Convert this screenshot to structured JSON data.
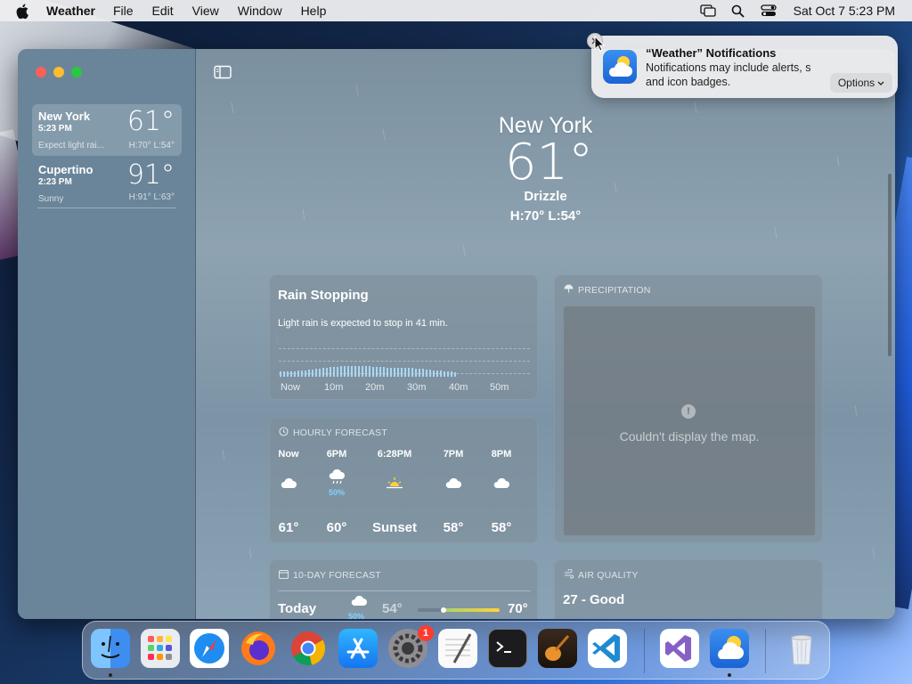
{
  "menubar": {
    "app_name": "Weather",
    "items": [
      "File",
      "Edit",
      "View",
      "Window",
      "Help"
    ],
    "clock": "Sat Oct 7  5:23 PM"
  },
  "sidebar": {
    "locations": [
      {
        "name": "New York",
        "time": "5:23 PM",
        "temp": "61°",
        "condition": "Expect light rai...",
        "high_low": "H:70°  L:54°"
      },
      {
        "name": "Cupertino",
        "time": "2:23 PM",
        "temp": "91°",
        "condition": "Sunny",
        "high_low": "H:91°  L:63°"
      }
    ]
  },
  "current": {
    "city": "New York",
    "temp": "61°",
    "condition": "Drizzle",
    "high_low": "H:70°  L:54°"
  },
  "rain_card": {
    "title": "Rain Stopping",
    "description": "Light rain is expected to stop in 41 min.",
    "axis": [
      "Now",
      "10m",
      "20m",
      "30m",
      "40m",
      "50m"
    ]
  },
  "hourly": {
    "title": "HOURLY FORECAST",
    "items": [
      {
        "time": "Now",
        "icon": "cloud-icon",
        "precip": "",
        "temp": "61°"
      },
      {
        "time": "6PM",
        "icon": "cloud-rain-icon",
        "precip": "50%",
        "temp": "60°"
      },
      {
        "time": "6:28PM",
        "icon": "sunset-icon",
        "precip": "",
        "temp": "Sunset"
      },
      {
        "time": "7PM",
        "icon": "cloud-icon",
        "precip": "",
        "temp": "58°"
      },
      {
        "time": "8PM",
        "icon": "cloud-icon",
        "precip": "",
        "temp": "58°"
      }
    ]
  },
  "precipitation": {
    "title": "PRECIPITATION",
    "message": "Couldn't display the map."
  },
  "tenday": {
    "title": "10-DAY FORECAST",
    "row": {
      "day": "Today",
      "precip": "50%",
      "low": "54°",
      "high": "70°"
    }
  },
  "air_quality": {
    "title": "AIR QUALITY",
    "value": "27 - Good"
  },
  "notification": {
    "title": "“Weather” Notifications",
    "line1": "Notifications may include alerts, s",
    "line2": "and icon badges.",
    "options": "Options"
  },
  "dock": {
    "apps": [
      "Finder",
      "Launchpad",
      "Safari",
      "Firefox",
      "Chrome",
      "App Store",
      "System Settings",
      "TextEdit",
      "Terminal",
      "GarageBand",
      "VS Code",
      "Visual Studio",
      "Weather",
      "Trash"
    ],
    "settings_badge": "1"
  },
  "colors": {
    "window_bg": "#8ea3b1",
    "sidebar_bg": "#6a8599",
    "precip_text": "#7fd3ff"
  }
}
